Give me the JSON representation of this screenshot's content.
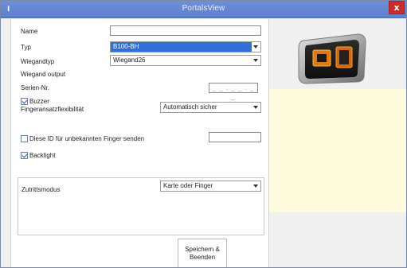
{
  "window": {
    "icon_text": "I",
    "title": "PortalsView",
    "close_label": "x"
  },
  "form": {
    "name_label": "Name",
    "name_value": "",
    "type_label": "Typ",
    "type_value": "B100-BH",
    "wiegand_type_label": "Wiegandtyp",
    "wiegand_type_value": "Wiegand26",
    "wiegand_output_label": "Wiegand output",
    "serial_label": "Serien-Nr.",
    "serial_value": "_ _ . _ _ . _ _",
    "buzzer_label": "Buzzer",
    "buzzer_checked": true,
    "finger_flex_label": "Fingeransatzflexibilität",
    "finger_flex_value": "Automatisch sicher",
    "unknown_finger_label": "Diese ID für unbekannten Finger senden",
    "unknown_finger_checked": false,
    "unknown_finger_value": "",
    "backlight_label": "Backlight",
    "backlight_checked": true,
    "access_mode_label": "Zutrittsmodus",
    "access_mode_value": "Karte oder Finger"
  },
  "actions": {
    "save_close_label": "Speichern &\nBeenden"
  },
  "colors": {
    "titlebar": "#5e7fcd",
    "close": "#cf2b2b",
    "selected": "#2f6fd8",
    "panel_yellow": "#fefcdc"
  }
}
